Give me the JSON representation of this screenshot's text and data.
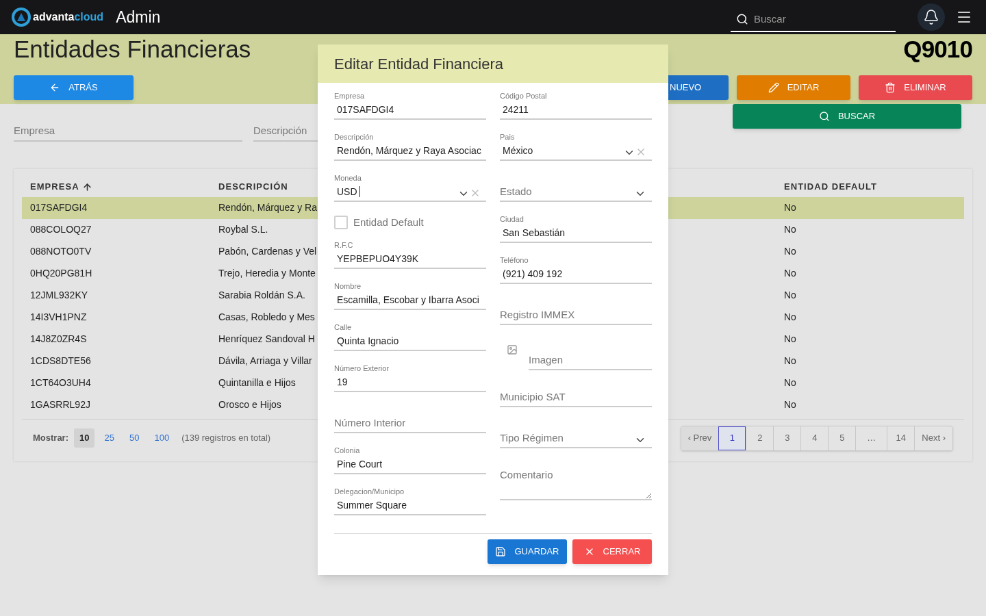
{
  "top_bar": {
    "logo": {
      "part_1": "advanta",
      "part_2": "cloud"
    },
    "app_title": "Admin",
    "search": {
      "placeholder": "Buscar"
    }
  },
  "page": {
    "title": "Entidades Financieras",
    "code": "Q9010",
    "buttons": [
      {
        "label": "ATRÁS",
        "kind": "back"
      },
      {
        "label": "NUEVO",
        "kind": "new"
      },
      {
        "label": "EDITAR",
        "kind": "edit"
      },
      {
        "label": "ELIMINAR",
        "kind": "delete"
      },
      {
        "label": "BUSCAR",
        "kind": "search"
      }
    ],
    "filters": [
      {
        "placeholder": "Empresa"
      },
      {
        "placeholder": "Descripción"
      }
    ]
  },
  "table": {
    "columns": [
      {
        "label": "EMPRESA",
        "sorted": true
      },
      {
        "label": "DESCRIPCIÓN",
        "sorted": false
      },
      {
        "label": "ENTIDAD DEFAULT",
        "sorted": false
      }
    ],
    "rows": [
      {
        "empresa": "017SAFDGI4",
        "descripcion": "Rendón, Márquez y Ra",
        "default": "No",
        "selected": true
      },
      {
        "empresa": "088COLOQ27",
        "descripcion": "Roybal S.L.",
        "default": "No",
        "selected": false
      },
      {
        "empresa": "088NOTO0TV",
        "descripcion": "Pabón, Cardenas y Vel",
        "default": "No",
        "selected": false
      },
      {
        "empresa": "0HQ20PG81H",
        "descripcion": "Trejo, Heredia y Monte",
        "default": "No",
        "selected": false
      },
      {
        "empresa": "12JML932KY",
        "descripcion": "Sarabia Roldán S.A.",
        "default": "No",
        "selected": false
      },
      {
        "empresa": "14I3VH1PNZ",
        "descripcion": "Casas, Robledo y Mes",
        "default": "No",
        "selected": false
      },
      {
        "empresa": "14J8Z0ZR4S",
        "descripcion": "Henríquez Sandoval H",
        "default": "No",
        "selected": false
      },
      {
        "empresa": "1CDS8DTE56",
        "descripcion": "Dávila, Arriaga y Villar",
        "default": "No",
        "selected": false
      },
      {
        "empresa": "1CT64O3UH4",
        "descripcion": "Quintanilla e Hijos",
        "default": "No",
        "selected": false
      },
      {
        "empresa": "1GASRRL92J",
        "descripcion": "Orosco e Hijos",
        "default": "No",
        "selected": false
      }
    ],
    "page_size": {
      "label": "Mostrar:",
      "options": [
        {
          "label": "10",
          "selected": true
        },
        {
          "label": "25",
          "selected": false
        },
        {
          "label": "50",
          "selected": false
        },
        {
          "label": "100",
          "selected": false
        }
      ],
      "total": "(139 registros en total)"
    },
    "pagination": [
      {
        "label": "‹ Prev",
        "kind": "nav",
        "selected": false
      },
      {
        "label": "1",
        "kind": "page",
        "selected": true
      },
      {
        "label": "2",
        "kind": "page",
        "selected": false
      },
      {
        "label": "3",
        "kind": "page",
        "selected": false
      },
      {
        "label": "4",
        "kind": "page",
        "selected": false
      },
      {
        "label": "5",
        "kind": "page",
        "selected": false
      },
      {
        "label": "…",
        "kind": "ellipsis"
      },
      {
        "label": "14",
        "kind": "page",
        "selected": false
      },
      {
        "label": "Next ›",
        "kind": "nav",
        "selected": false
      }
    ]
  },
  "dialog": {
    "title": "Editar Entidad Financiera",
    "left_fields": [
      {
        "kind": "text",
        "label": "Empresa",
        "value": "017SAFDGI4"
      },
      {
        "kind": "text",
        "label": "Descripción",
        "value": "Rendón, Márquez y Raya Asociac"
      },
      {
        "kind": "select",
        "label": "Moneda",
        "value": "USD",
        "clearable": true,
        "focused": true
      },
      {
        "kind": "checkbox",
        "label": "Entidad Default",
        "checked": false
      },
      {
        "kind": "text",
        "label": "R.F.C",
        "value": "YEPBEPUO4Y39K"
      },
      {
        "kind": "text",
        "label": "Nombre",
        "value": "Escamilla, Escobar y Ibarra Asoci"
      },
      {
        "kind": "text",
        "label": "Calle",
        "value": "Quinta Ignacio"
      },
      {
        "kind": "text",
        "label": "Número Exterior",
        "value": "19"
      },
      {
        "kind": "text",
        "placeholder": "Número Interior"
      },
      {
        "kind": "text",
        "label": "Colonia",
        "value": "Pine Court"
      },
      {
        "kind": "text",
        "label": "Delegacion/Municipo",
        "value": "Summer Square"
      }
    ],
    "right_fields": [
      {
        "kind": "text",
        "label": "Código Postal",
        "value": "24211"
      },
      {
        "kind": "select",
        "label": "Pais",
        "value": "México",
        "clearable": true,
        "focused": false
      },
      {
        "kind": "select",
        "placeholder": "Estado",
        "clearable": false,
        "focused": false
      },
      {
        "kind": "text",
        "label": "Ciudad",
        "value": "San Sebastián"
      },
      {
        "kind": "text",
        "label": "Teléfono",
        "value": "(921) 409 192"
      },
      {
        "kind": "text",
        "placeholder": "Registro IMMEX"
      },
      {
        "kind": "file",
        "placeholder": "Imagen"
      },
      {
        "kind": "text",
        "placeholder": "Municipio SAT"
      },
      {
        "kind": "select",
        "placeholder": "Tipo Régimen",
        "clearable": false,
        "focused": false
      },
      {
        "kind": "textarea",
        "placeholder": "Comentario"
      }
    ],
    "buttons": [
      {
        "label": "GUARDAR",
        "kind": "save"
      },
      {
        "label": "CERRAR",
        "kind": "close"
      }
    ]
  }
}
